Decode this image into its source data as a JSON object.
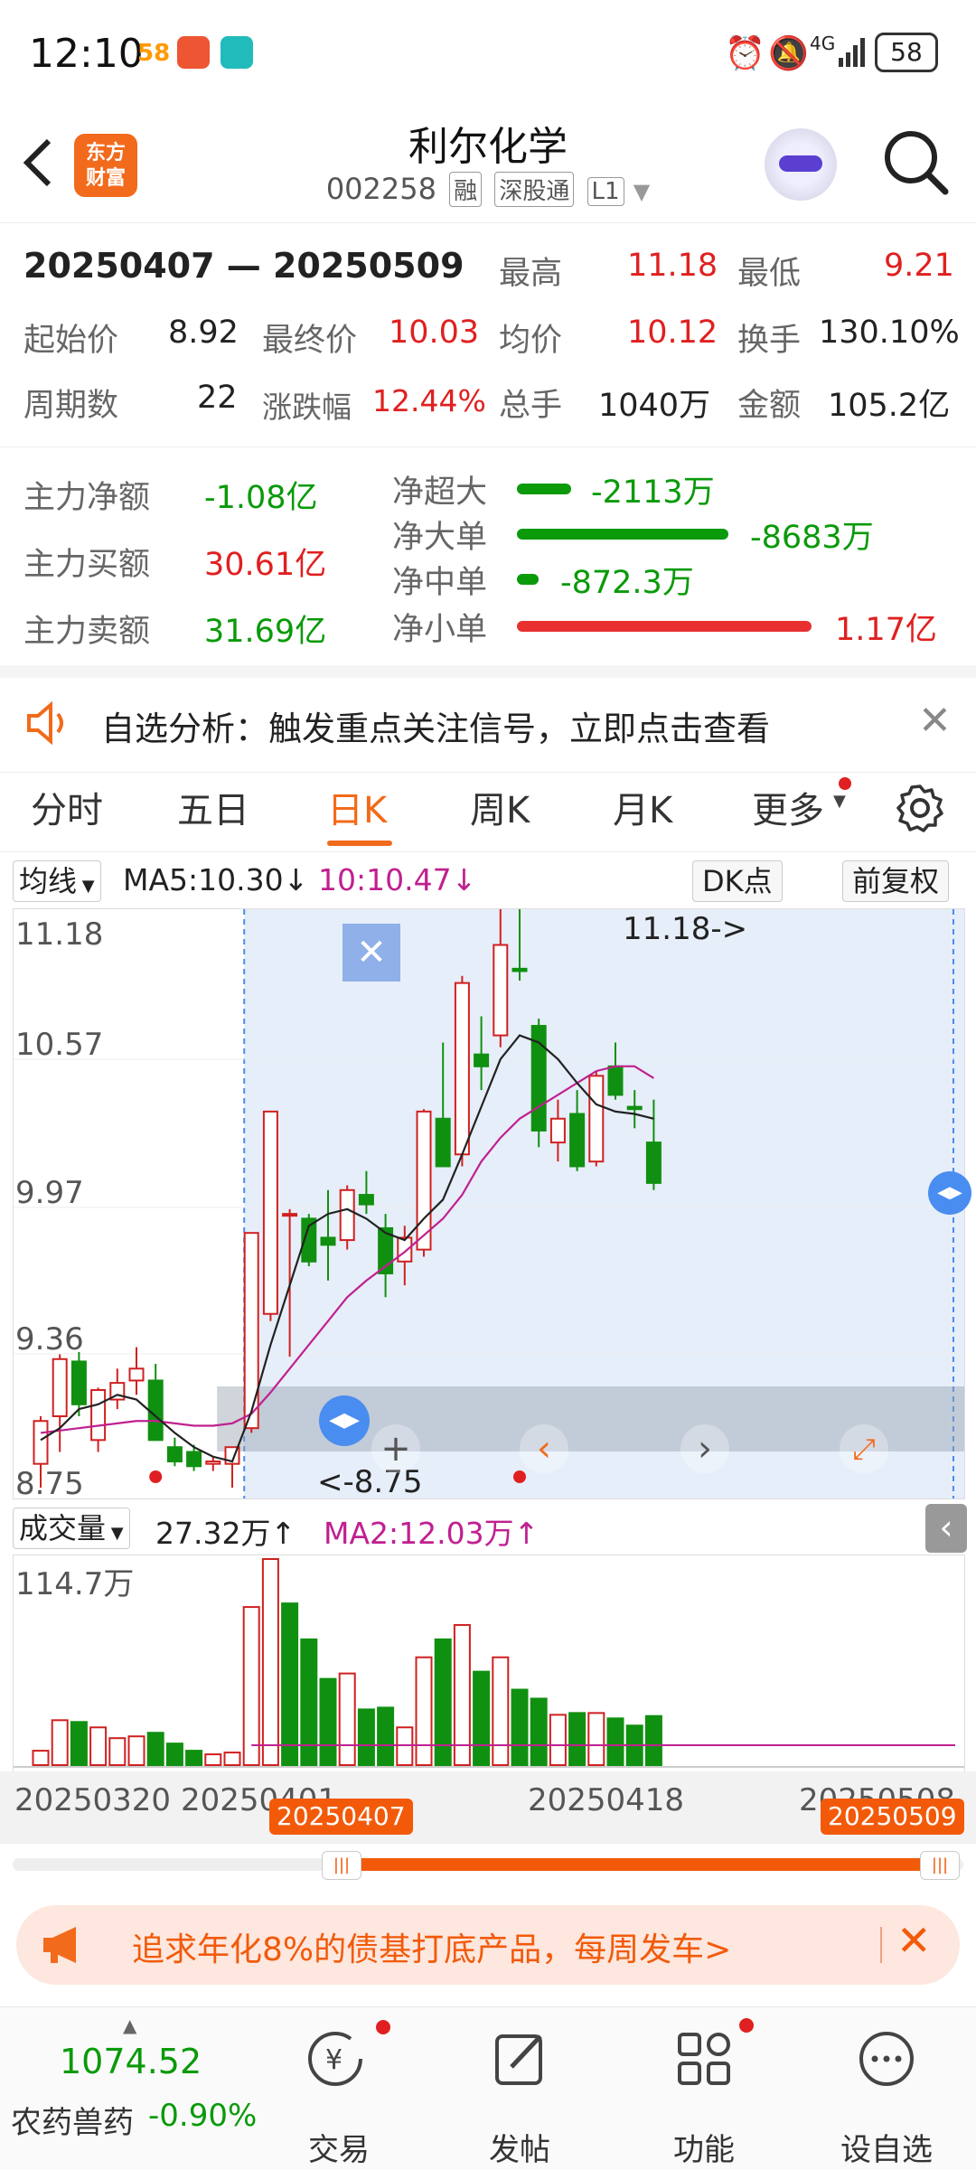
{
  "status": {
    "time": "12:10",
    "battery": "58",
    "network": "4G"
  },
  "header": {
    "title": "利尔化学",
    "code": "002258",
    "tags": [
      "融",
      "深股通",
      "L1"
    ],
    "logo": "东方\n财富"
  },
  "summary": {
    "range": "20250407 — 20250509",
    "high_label": "最高",
    "high": "11.18",
    "low_label": "最低",
    "low": "9.21",
    "start_label": "起始价",
    "start": "8.92",
    "end_label": "最终价",
    "end": "10.03",
    "avg_label": "均价",
    "avg": "10.12",
    "turnover_label": "换手",
    "turnover": "130.10%",
    "periods_label": "周期数",
    "periods": "22",
    "change_label": "涨跌幅",
    "change": "12.44%",
    "volume_label": "总手",
    "volume": "1040万",
    "amount_label": "金额",
    "amount": "105.2亿"
  },
  "flow": {
    "net_label": "主力净额",
    "net": "-1.08亿",
    "buy_label": "主力买额",
    "buy": "30.61亿",
    "sell_label": "主力卖额",
    "sell": "31.69亿",
    "items": [
      {
        "label": "净超大",
        "value": "-2113万",
        "fraction": 0.18
      },
      {
        "label": "净大单",
        "value": "-8683万",
        "fraction": 0.72
      },
      {
        "label": "净中单",
        "value": "-872.3万",
        "fraction": 0.07
      },
      {
        "label": "净小单",
        "value": "1.17亿",
        "fraction": 1.0
      }
    ]
  },
  "notice": {
    "text": "自选分析：触发重点关注信号，立即点击查看"
  },
  "tabs": [
    "分时",
    "五日",
    "日K",
    "周K",
    "月K",
    "更多"
  ],
  "active_tab": "日K",
  "indicators": {
    "ma_select": "均线",
    "ma5": "MA5:10.30",
    "ma10": "10:10.47",
    "dk": "DK点",
    "adjust": "前复权"
  },
  "price_axis": [
    "11.18",
    "10.57",
    "9.97",
    "9.36",
    "8.75"
  ],
  "annotations": {
    "high_mark": "11.18->",
    "low_mark": "<-8.75"
  },
  "volume": {
    "label": "成交量",
    "value": "27.32万",
    "ma2": "MA2:12.03万",
    "max": "114.7万"
  },
  "date_axis": [
    "20250320",
    "20250401",
    "20250418",
    "20250508"
  ],
  "range_handles": {
    "start": "20250407",
    "end": "20250509"
  },
  "banner": {
    "text": "追求年化8%的债基打底产品，每周发车>"
  },
  "bottom": {
    "index_value": "1074.52",
    "index_name": "农药兽药",
    "index_change": "-0.90%",
    "nav": [
      "交易",
      "发帖",
      "功能",
      "设自选"
    ]
  },
  "chart_data": {
    "type": "candlestick",
    "ylim": [
      8.75,
      11.18
    ],
    "candles": [
      {
        "o": 8.85,
        "h": 9.05,
        "l": 8.75,
        "c": 9.03,
        "dir": "up"
      },
      {
        "o": 9.05,
        "h": 9.31,
        "l": 8.9,
        "c": 9.29,
        "dir": "up"
      },
      {
        "o": 9.28,
        "h": 9.32,
        "l": 9.05,
        "c": 9.1,
        "dir": "down"
      },
      {
        "o": 8.95,
        "h": 9.17,
        "l": 8.9,
        "c": 9.16,
        "dir": "up"
      },
      {
        "o": 9.12,
        "h": 9.25,
        "l": 9.08,
        "c": 9.19,
        "dir": "up"
      },
      {
        "o": 9.2,
        "h": 9.34,
        "l": 9.14,
        "c": 9.25,
        "dir": "up"
      },
      {
        "o": 9.2,
        "h": 9.27,
        "l": 8.95,
        "c": 8.95,
        "dir": "down"
      },
      {
        "o": 8.92,
        "h": 8.96,
        "l": 8.84,
        "c": 8.86,
        "dir": "down"
      },
      {
        "o": 8.9,
        "h": 8.93,
        "l": 8.82,
        "c": 8.84,
        "dir": "down"
      },
      {
        "o": 8.85,
        "h": 8.88,
        "l": 8.82,
        "c": 8.86,
        "dir": "up"
      },
      {
        "o": 8.85,
        "h": 8.92,
        "l": 8.75,
        "c": 8.92,
        "dir": "up"
      },
      {
        "o": 9.0,
        "h": 9.82,
        "l": 8.98,
        "c": 9.82,
        "dir": "up"
      },
      {
        "o": 9.48,
        "h": 10.33,
        "l": 9.45,
        "c": 10.33,
        "dir": "up"
      },
      {
        "o": 9.9,
        "h": 9.92,
        "l": 9.3,
        "c": 9.9,
        "dir": "up"
      },
      {
        "o": 9.88,
        "h": 9.9,
        "l": 9.68,
        "c": 9.7,
        "dir": "down"
      },
      {
        "o": 9.8,
        "h": 10.0,
        "l": 9.62,
        "c": 9.77,
        "dir": "down"
      },
      {
        "o": 9.79,
        "h": 10.02,
        "l": 9.75,
        "c": 10.0,
        "dir": "up"
      },
      {
        "o": 9.98,
        "h": 10.08,
        "l": 9.9,
        "c": 9.94,
        "dir": "down"
      },
      {
        "o": 9.84,
        "h": 9.9,
        "l": 9.55,
        "c": 9.65,
        "dir": "down"
      },
      {
        "o": 9.7,
        "h": 9.85,
        "l": 9.6,
        "c": 9.8,
        "dir": "up"
      },
      {
        "o": 9.75,
        "h": 10.34,
        "l": 9.72,
        "c": 10.33,
        "dir": "up"
      },
      {
        "o": 10.3,
        "h": 10.62,
        "l": 10.1,
        "c": 10.1,
        "dir": "down"
      },
      {
        "o": 10.15,
        "h": 10.9,
        "l": 10.1,
        "c": 10.87,
        "dir": "up"
      },
      {
        "o": 10.57,
        "h": 10.73,
        "l": 10.42,
        "c": 10.52,
        "dir": "down"
      },
      {
        "o": 10.65,
        "h": 11.18,
        "l": 10.6,
        "c": 11.03,
        "dir": "up"
      },
      {
        "o": 10.92,
        "h": 11.18,
        "l": 10.88,
        "c": 10.93,
        "dir": "down"
      },
      {
        "o": 10.69,
        "h": 10.72,
        "l": 10.18,
        "c": 10.25,
        "dir": "down"
      },
      {
        "o": 10.2,
        "h": 10.38,
        "l": 10.12,
        "c": 10.3,
        "dir": "up"
      },
      {
        "o": 10.32,
        "h": 10.42,
        "l": 10.08,
        "c": 10.1,
        "dir": "down"
      },
      {
        "o": 10.12,
        "h": 10.5,
        "l": 10.1,
        "c": 10.48,
        "dir": "up"
      },
      {
        "o": 10.52,
        "h": 10.62,
        "l": 10.38,
        "c": 10.4,
        "dir": "down"
      },
      {
        "o": 10.35,
        "h": 10.42,
        "l": 10.26,
        "c": 10.34,
        "dir": "down"
      },
      {
        "o": 10.2,
        "h": 10.38,
        "l": 10.0,
        "c": 10.03,
        "dir": "down"
      }
    ],
    "ma5": [
      8.95,
      9.0,
      9.08,
      9.1,
      9.14,
      9.12,
      9.05,
      8.98,
      8.92,
      8.88,
      8.86,
      9.07,
      9.35,
      9.6,
      9.85,
      9.9,
      9.92,
      9.88,
      9.82,
      9.79,
      9.88,
      9.96,
      10.15,
      10.35,
      10.55,
      10.65,
      10.62,
      10.55,
      10.45,
      10.36,
      10.33,
      10.32,
      10.3
    ],
    "ma10": [
      8.98,
      8.99,
      9.0,
      9.01,
      9.02,
      9.03,
      9.03,
      9.02,
      9.01,
      9.01,
      9.02,
      9.06,
      9.15,
      9.25,
      9.35,
      9.45,
      9.55,
      9.62,
      9.68,
      9.74,
      9.81,
      9.88,
      9.98,
      10.12,
      10.22,
      10.3,
      10.35,
      10.4,
      10.45,
      10.5,
      10.52,
      10.52,
      10.47
    ],
    "volumes": [
      {
        "v": 8,
        "dir": "up"
      },
      {
        "v": 25,
        "dir": "up"
      },
      {
        "v": 24,
        "dir": "down"
      },
      {
        "v": 21,
        "dir": "up"
      },
      {
        "v": 15,
        "dir": "up"
      },
      {
        "v": 16,
        "dir": "up"
      },
      {
        "v": 18,
        "dir": "down"
      },
      {
        "v": 12,
        "dir": "down"
      },
      {
        "v": 8,
        "dir": "down"
      },
      {
        "v": 6,
        "dir": "up"
      },
      {
        "v": 7,
        "dir": "up"
      },
      {
        "v": 88,
        "dir": "up"
      },
      {
        "v": 114.7,
        "dir": "up"
      },
      {
        "v": 90,
        "dir": "down"
      },
      {
        "v": 70,
        "dir": "down"
      },
      {
        "v": 48,
        "dir": "down"
      },
      {
        "v": 51,
        "dir": "up"
      },
      {
        "v": 31,
        "dir": "down"
      },
      {
        "v": 32,
        "dir": "down"
      },
      {
        "v": 21,
        "dir": "up"
      },
      {
        "v": 60,
        "dir": "up"
      },
      {
        "v": 70,
        "dir": "down"
      },
      {
        "v": 78,
        "dir": "up"
      },
      {
        "v": 52,
        "dir": "down"
      },
      {
        "v": 60,
        "dir": "up"
      },
      {
        "v": 42,
        "dir": "down"
      },
      {
        "v": 37,
        "dir": "down"
      },
      {
        "v": 28,
        "dir": "up"
      },
      {
        "v": 29,
        "dir": "down"
      },
      {
        "v": 29,
        "dir": "up"
      },
      {
        "v": 26,
        "dir": "down"
      },
      {
        "v": 22,
        "dir": "down"
      },
      {
        "v": 27.32,
        "dir": "down"
      }
    ],
    "vol_max": 114.7
  }
}
